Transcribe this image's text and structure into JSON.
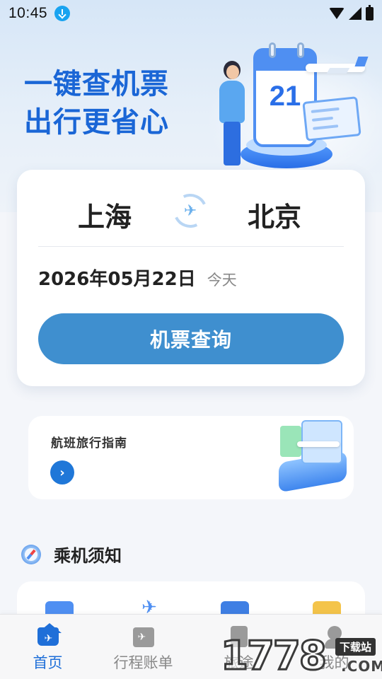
{
  "status_bar": {
    "time": "10:45",
    "download_icon": "download-icon",
    "wifi_icon": "wifi-icon",
    "signal_icon": "signal-icon",
    "battery_icon": "battery-icon"
  },
  "hero": {
    "title_line1": "一键查机票",
    "title_line2": "出行更省心",
    "calendar_number": "21",
    "accent_color": "#1a66d6"
  },
  "search": {
    "from_city": "上海",
    "to_city": "北京",
    "swap_icon": "swap-plane-icon",
    "date": "2026年05月22日",
    "date_label": "今天",
    "query_button": "机票查询",
    "button_color": "#3f8fcf"
  },
  "guide": {
    "title": "航班旅行指南",
    "arrow_icon": "chevron-right-icon",
    "arrow_glyph": "›"
  },
  "notice": {
    "icon": "compass-icon",
    "title": "乘机须知"
  },
  "tabs": [
    {
      "label": "首页",
      "icon": "home-icon",
      "active": true
    },
    {
      "label": "行程账单",
      "icon": "calendar-plane-icon",
      "active": false
    },
    {
      "label": "旅途",
      "icon": "document-icon",
      "active": false
    },
    {
      "label": "我的",
      "icon": "user-icon",
      "active": false
    }
  ],
  "watermark": {
    "digits": "1778",
    "badge": "下载站",
    "domain": ".COM"
  }
}
